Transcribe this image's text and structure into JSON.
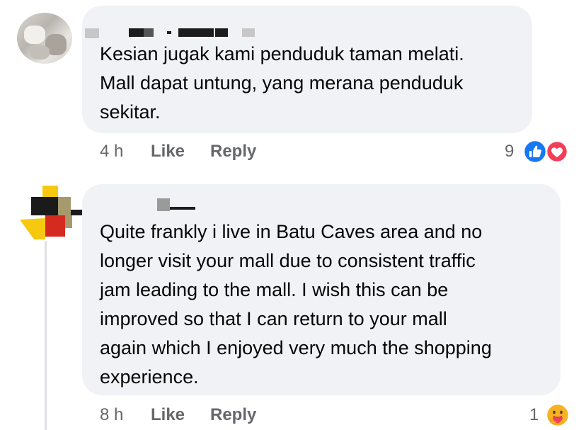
{
  "comments": [
    {
      "text_lines": [
        "Kesian jugak kami penduduk taman melati.",
        "Mall dapat untung, yang merana penduduk",
        "sekitar."
      ],
      "time": "4 h",
      "like_label": "Like",
      "reply_label": "Reply",
      "reaction_count": "9",
      "reactions": [
        "like-reaction-icon",
        "love-reaction-icon"
      ]
    },
    {
      "text_lines": [
        "Quite frankly i live in Batu Caves area and no",
        "longer visit your mall due to consistent traffic",
        "jam leading to the mall. I wish this can be",
        "improved so that I can return to your mall",
        "again which I enjoyed very much the shopping",
        "experience."
      ],
      "time": "8 h",
      "like_label": "Like",
      "reply_label": "Reply",
      "reaction_count": "1",
      "reactions": [
        "care-reaction-icon"
      ]
    }
  ],
  "colors": {
    "bubble": "#f0f2f5",
    "meta_text": "#65676b",
    "like_blue": "#1877f2",
    "love_red": "#f33e58",
    "care_yellow": "#f7b125"
  }
}
